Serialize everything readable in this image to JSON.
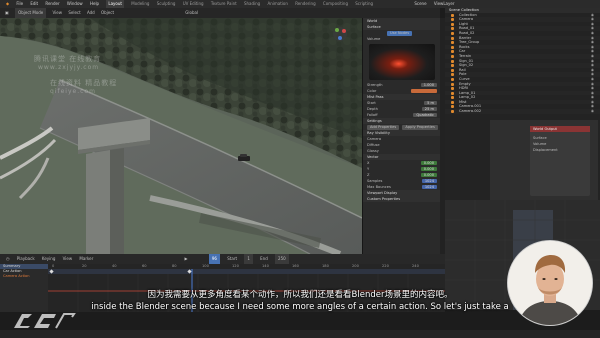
{
  "app": {
    "name": "Blender"
  },
  "topbar": {
    "menus": [
      "File",
      "Edit",
      "Render",
      "Window",
      "Help"
    ],
    "workspaces": [
      "Layout",
      "Modeling",
      "Sculpting",
      "UV Editing",
      "Texture Paint",
      "Shading",
      "Animation",
      "Rendering",
      "Compositing",
      "Scripting"
    ],
    "active_workspace": "Layout",
    "scene_label": "Scene",
    "view_layer_label": "ViewLayer"
  },
  "viewport": {
    "mode": "Object Mode",
    "menus": [
      "View",
      "Select",
      "Add",
      "Object"
    ],
    "shading": "Global"
  },
  "watermark": {
    "line1": "腾讯课堂 在线教育",
    "line2": "www.zxjyjy.com",
    "line3": "在线资料 精品教程",
    "line4": "qifeiye.com"
  },
  "properties": {
    "world_label": "World",
    "surface_section": "Surface",
    "use_nodes": "Use Nodes",
    "strength_label": "Strength",
    "strength_value": "1.000",
    "mist_section": "Mist Pass",
    "start_label": "Start",
    "start_value": "5 m",
    "depth_label": "Depth",
    "depth_value": "25 m",
    "falloff_label": "Falloff",
    "falloff_value": "Quadratic",
    "settings_section": "Settings",
    "visibility_section": "Ray Visibility",
    "camera_label": "Camera",
    "diffuse_label": "Diffuse",
    "glossy_label": "Glossy",
    "buttons": [
      "Add Properties",
      "Apply Properties"
    ],
    "vector_section": "Vector",
    "vector_x_label": "X",
    "vector_x": "0.000",
    "vector_y_label": "Y",
    "vector_y": "0.000",
    "vector_z_label": "Z",
    "vector_z": "0.000",
    "samples_label": "Samples",
    "samples_value": "1024",
    "max_bounces_label": "Max Bounces",
    "max_bounces_value": "1024",
    "color_label": "Color",
    "volume_section": "Volume",
    "viewport_display": "Viewport Display",
    "custom_props": "Custom Properties"
  },
  "outliner": {
    "title": "Scene Collection",
    "items": [
      "Collection",
      "Camera",
      "Light",
      "Road_01",
      "Road_02",
      "Barrier",
      "Tree_Group",
      "Rocks",
      "Car",
      "Terrain",
      "Sign_01",
      "Sign_02",
      "Rail",
      "Pole",
      "Curve",
      "Empty",
      "HDRI",
      "Lamp_01",
      "Lamp_02",
      "Mist",
      "Camera.001",
      "Camera.002"
    ]
  },
  "nodes": {
    "surface_label": "Surface",
    "volume_label": "Volume",
    "displacement_label": "Displacement",
    "output_label": "World Output"
  },
  "timeline": {
    "menus": [
      "Playback",
      "Keying",
      "View",
      "Marker"
    ],
    "current_frame": "96",
    "start_label": "Start",
    "start_value": "1",
    "end_label": "End",
    "end_value": "250",
    "ticks": [
      "0",
      "20",
      "40",
      "60",
      "80",
      "100",
      "120",
      "140",
      "160",
      "180",
      "200",
      "220",
      "240"
    ],
    "channels": [
      "Summary",
      "Car Action",
      "Camera Action"
    ]
  },
  "subtitles": {
    "zh": "因为我需要从更多角度看某个动作，所以我们还是看看Blender场景里的内容吧。",
    "en": "inside the Blender scene because I need some more angles of a certain action. So let's just take a"
  },
  "colors": {
    "accent_blue": "#4772b3",
    "keyframe_orange": "#e08a2e",
    "playhead": "#4b7bd2",
    "value_green": "#3f7a3c",
    "value_blue": "#4666a8"
  }
}
